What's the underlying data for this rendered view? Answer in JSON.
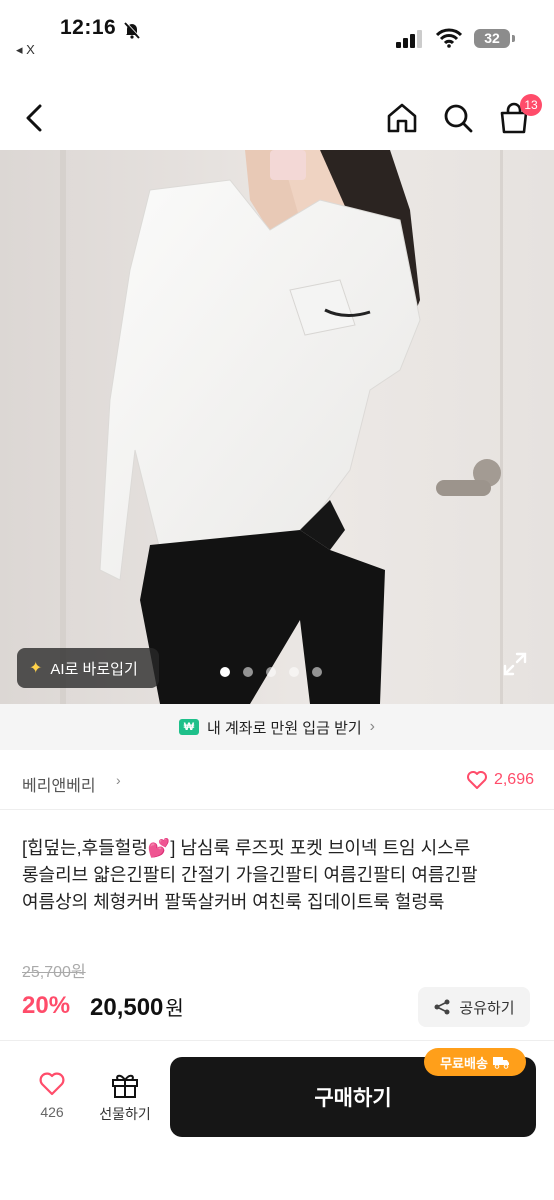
{
  "status_bar": {
    "time": "12:16",
    "back_app": "◂ X",
    "battery": "32"
  },
  "nav": {
    "cart_count": "13"
  },
  "product_image": {
    "ai_button_label": "AI로 바로입기",
    "total_dots": 5,
    "active_dot": 1
  },
  "promo": {
    "won_symbol": "₩",
    "text": "내 계좌로 만원 입금 받기"
  },
  "seller": {
    "name": "베리앤베리",
    "likes": "2,696"
  },
  "product": {
    "title": "[힙덮는,후들헐렁💕] 남심룩 루즈핏 포켓 브이넥 트임 시스루 롱슬리브 얇은긴팔티 간절기 가을긴팔티 여름긴팔티 여름긴팔 여름상의 체형커버 팔뚝살커버 여친룩 집데이트룩 헐렁룩",
    "original_price": "25,700원",
    "discount": "20%",
    "price": "20,500",
    "price_unit": "원",
    "share_label": "공유하기"
  },
  "bottom_bar": {
    "like_count": "426",
    "gift_label": "선물하기",
    "buy_label": "구매하기",
    "free_shipping": "무료배송"
  },
  "colors": {
    "accent": "#ff4c6a",
    "buy_button": "#161616",
    "free_shipping": "#ff9f1a",
    "won_badge": "#1ec08a"
  }
}
